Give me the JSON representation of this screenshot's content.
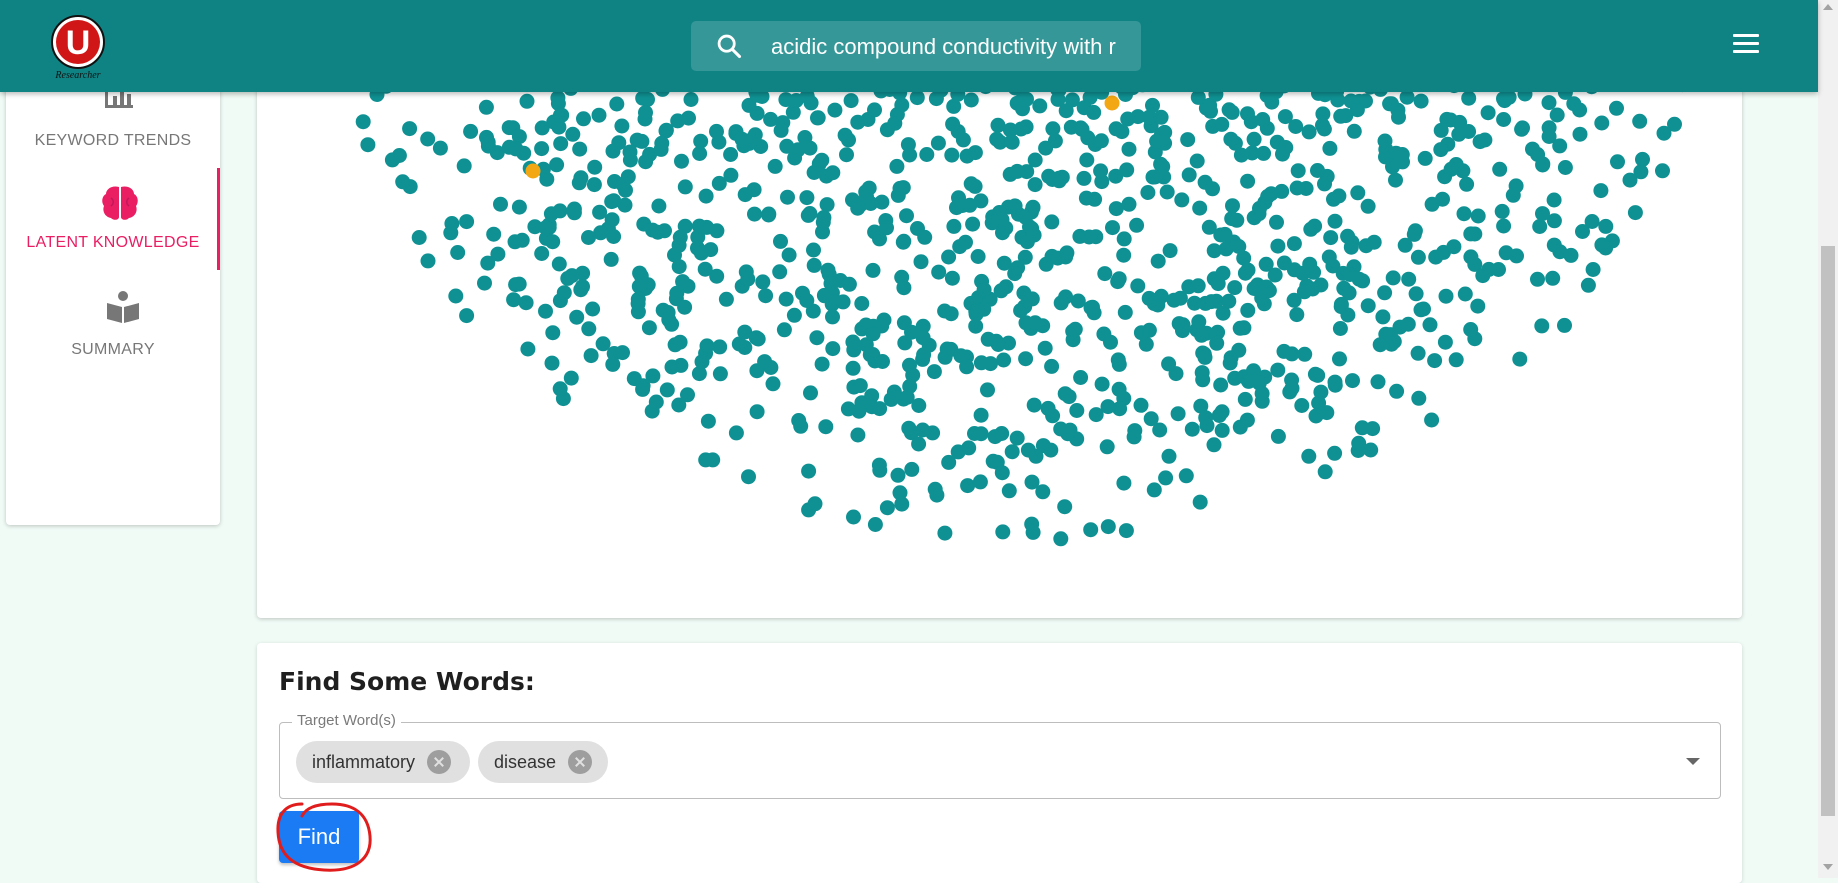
{
  "app": {
    "logo_letter": "U",
    "logo_caption": "Researcher"
  },
  "search": {
    "value": "acidic compound conductivity with r",
    "icon": "search-icon"
  },
  "header": {
    "menu_icon": "hamburger-menu-icon"
  },
  "sidebar": {
    "items": [
      {
        "label": "KEYWORD TRENDS",
        "icon": "bar-chart-icon",
        "active": false
      },
      {
        "label": "LATENT KNOWLEDGE",
        "icon": "brain-icon",
        "active": true
      },
      {
        "label": "SUMMARY",
        "icon": "reading-book-icon",
        "active": false
      }
    ]
  },
  "colors": {
    "header": "#0f8384",
    "point": "#0f9193",
    "highlight_point": "#f3a712",
    "active_nav": "#e91e63",
    "find_button": "#1a7bf5",
    "annotation": "#e01c1c"
  },
  "scatter": {
    "highlight_count": 2
  },
  "find_section": {
    "title": "Find Some Words:",
    "field_label": "Target Word(s)",
    "chips": [
      "inflammatory",
      "disease"
    ],
    "button_label": "Find"
  }
}
